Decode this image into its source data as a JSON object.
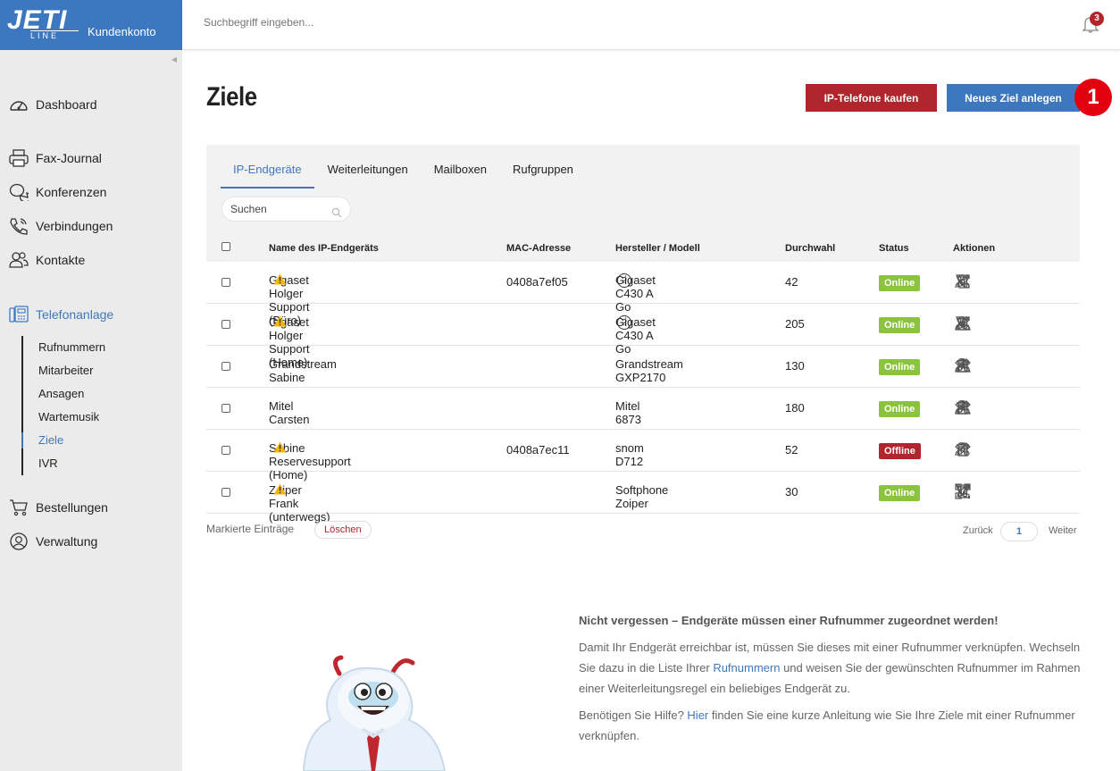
{
  "brand": {
    "logo_top": "JETI",
    "logo_bottom": "LINE",
    "subtitle": "Kundenkonto"
  },
  "topbar": {
    "search_placeholder": "Suchbegriff eingeben...",
    "notifications_count": "3"
  },
  "sidebar": {
    "items": [
      {
        "label": "Dashboard",
        "icon": "speedometer-icon"
      },
      {
        "label": "Fax-Journal",
        "icon": "fax-icon"
      },
      {
        "label": "Konferenzen",
        "icon": "chat-icon"
      },
      {
        "label": "Verbindungen",
        "icon": "phone-icon"
      },
      {
        "label": "Kontakte",
        "icon": "contacts-icon"
      },
      {
        "label": "Telefonanlage",
        "icon": "pbx-icon"
      },
      {
        "label": "Bestellungen",
        "icon": "cart-icon"
      },
      {
        "label": "Verwaltung",
        "icon": "user-circle-icon"
      }
    ],
    "subitems": [
      "Rufnummern",
      "Mitarbeiter",
      "Ansagen",
      "Wartemusik",
      "Ziele",
      "IVR"
    ]
  },
  "page": {
    "title": "Ziele",
    "btn_buy": "IP-Telefone kaufen",
    "btn_new": "Neues Ziel anlegen",
    "step_badge": "1"
  },
  "tabs": [
    "IP-Endgeräte",
    "Weiterleitungen",
    "Mailboxen",
    "Rufgruppen"
  ],
  "table": {
    "search_placeholder": "Suchen",
    "headers": {
      "name": "Name des IP-Endgeräts",
      "mac": "MAC-Adresse",
      "model": "Hersteller / Modell",
      "ext": "Durchwahl",
      "status": "Status",
      "actions": "Aktionen"
    },
    "rows": [
      {
        "name": "Gigaset Holger Support (Büro)",
        "warn": true,
        "mac": "0408a7ef05",
        "model": "Gigaset C430 A Go",
        "help": true,
        "ext": "42",
        "status": "Online",
        "actions": [
          "user-settings-icon",
          "edit-icon",
          "call-forward-icon",
          "trash-icon"
        ]
      },
      {
        "name": "Gigaset Holger Support (Home)",
        "warn": true,
        "mac": "",
        "model": "Gigaset C430 A Go",
        "help": true,
        "ext": "205",
        "status": "Online",
        "actions": [
          "user-settings-icon",
          "edit-icon",
          "trash-icon",
          "call-forward-icon",
          "download-icon"
        ]
      },
      {
        "name": "Grandstream Sabine",
        "warn": false,
        "mac": "",
        "model": "Grandstream GXP2170",
        "help": false,
        "ext": "130",
        "status": "Online",
        "actions": [
          "user-settings-icon",
          "edit-icon",
          "desk-phone-icon",
          "trash-icon",
          "download-icon"
        ]
      },
      {
        "name": "Mitel Carsten",
        "warn": false,
        "mac": "",
        "model": "Mitel 6873",
        "help": false,
        "ext": "180",
        "status": "Online",
        "actions": [
          "user-settings-icon",
          "edit-icon",
          "desk-phone-icon",
          "trash-icon",
          "download-icon"
        ]
      },
      {
        "name": "Sabine Reservesupport (Home)",
        "warn": true,
        "mac": "0408a7ec11",
        "model": "snom D712",
        "help": false,
        "ext": "52",
        "status": "Offline",
        "actions": [
          "user-settings-icon",
          "edit-icon",
          "desk-phone-icon",
          "trash-icon"
        ]
      },
      {
        "name": "Zoiper Frank (unterwegs)",
        "warn": true,
        "mac": "",
        "model": "Softphone Zoiper",
        "help": false,
        "ext": "30",
        "status": "Online",
        "actions": [
          "qr-code-icon",
          "edit-icon",
          "call-forward-icon",
          "trash-icon"
        ]
      }
    ],
    "marked_label": "Markierte Einträge",
    "delete_label": "Löschen",
    "pager": {
      "prev": "Zurück",
      "page": "1",
      "next": "Weiter"
    }
  },
  "info": {
    "heading": "Nicht vergessen – Endgeräte müssen einer Rufnummer zugeordnet werden!",
    "p1_before": "Damit Ihr Endgerät erreichbar ist, müssen Sie dieses mit einer Rufnummer verknüpfen. Wechseln Sie dazu in die Liste Ihrer ",
    "p1_link": "Rufnummern",
    "p1_after": " und weisen Sie der gewünschten Rufnummer im Rahmen einer Weiterleitungsregel ein beliebiges Endgerät zu.",
    "p2_before": "Benötigen Sie Hilfe? ",
    "p2_link": "Hier",
    "p2_after": " finden Sie eine kurze Anleitung wie Sie Ihre Ziele mit einer Rufnummer verknüpfen."
  },
  "colors": {
    "brand": "#3d78bf",
    "danger": "#b1262c",
    "online": "#8bc33f",
    "badge": "#e3000f",
    "sidebar_bg": "#ebebeb",
    "panel_bg": "#f2f2f2"
  }
}
